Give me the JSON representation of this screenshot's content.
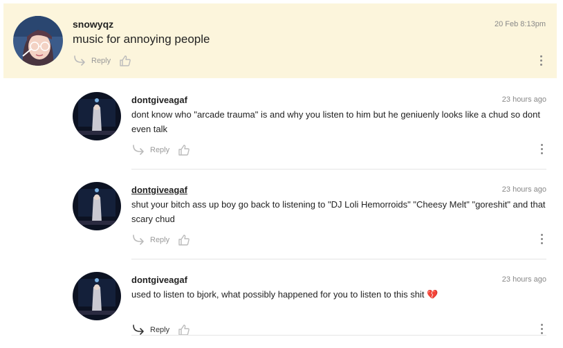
{
  "top_comment": {
    "username": "snowyqz",
    "timestamp": "20 Feb 8:13pm",
    "text": "music for annoying people",
    "reply_label": "Reply"
  },
  "replies": [
    {
      "username": "dontgiveagaf",
      "timestamp": "23 hours ago",
      "text": "dont know who \"arcade trauma\" is and why you listen to him but he geniuenly looks like a chud so dont even talk",
      "reply_label": "Reply"
    },
    {
      "username": "dontgiveagaf",
      "timestamp": "23 hours ago",
      "text": "shut your bitch ass up boy go back to listening to \"DJ Loli Hemorroids\" \"Cheesy Melt\" \"goreshit\" and that scary chud",
      "reply_label": "Reply"
    },
    {
      "username": "dontgiveagaf",
      "timestamp": "23 hours ago",
      "text": "used to listen to bjork, what possibly happened for you to listen to this shit",
      "emoji": "💔",
      "reply_label": "Reply"
    }
  ],
  "icons": {
    "reply": "reply-arrow-icon",
    "like": "thumbs-up-icon",
    "more": "more-options-icon"
  },
  "colors": {
    "highlight_background": "#fcf5dc",
    "text": "#222222",
    "muted": "#888888",
    "divider": "#e5e5e5"
  }
}
